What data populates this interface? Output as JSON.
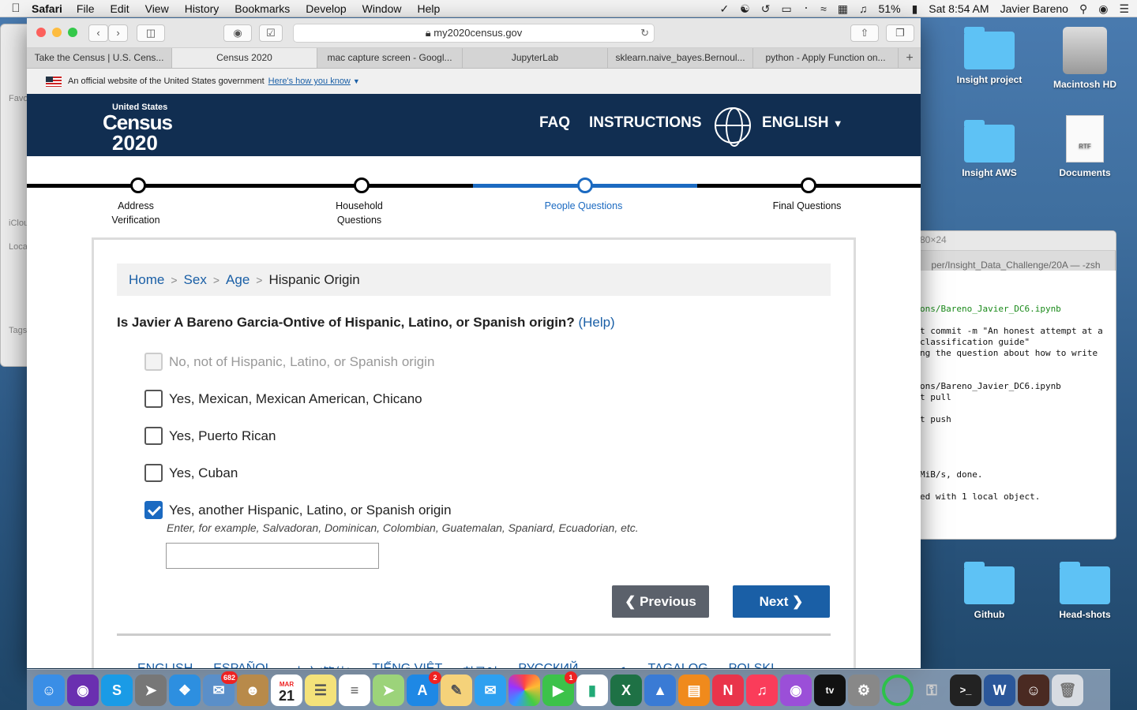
{
  "menubar": {
    "app": "Safari",
    "items": [
      "File",
      "Edit",
      "View",
      "History",
      "Bookmarks",
      "Develop",
      "Window",
      "Help"
    ],
    "battery": "51%",
    "clock": "Sat 8:54 AM",
    "user": "Javier Bareno"
  },
  "desktop": {
    "items": [
      {
        "label": "Insight project"
      },
      {
        "label": "Macintosh HD"
      },
      {
        "label": "Insight AWS"
      },
      {
        "label": "Documents"
      },
      {
        "label": "Github"
      },
      {
        "label": "Head-shots"
      }
    ]
  },
  "terminal": {
    "title": "80×24",
    "tab": "per/Insight_Data_Challenge/20A — -zsh",
    "lines": [
      "ons/Bareno_Javier_DC6.ipynb",
      "t commit -m \"An honest attempt at a",
      "classification guide\"",
      "ng the question about how to write",
      "ons/Bareno_Javier_DC6.ipynb",
      "t pull",
      "t push",
      "MiB/s, done.",
      "ed with 1 local object."
    ]
  },
  "safari": {
    "url": "my2020census.gov",
    "tabs": [
      "Take the Census | U.S. Cens...",
      "Census 2020",
      "mac capture screen - Googl...",
      "JupyterLab",
      "sklearn.naive_bayes.Bernoul...",
      "python - Apply Function on..."
    ],
    "active_tab": 1
  },
  "gov_banner": {
    "text": "An official website of the United States government",
    "link": "Here's how you know"
  },
  "header": {
    "logo_top": "United States",
    "logo_mid": "Census",
    "logo_year": "2020",
    "faq": "FAQ",
    "instructions": "INSTRUCTIONS",
    "language": "ENGLISH"
  },
  "progress": {
    "steps": [
      {
        "label": "Address Verification"
      },
      {
        "label": "Household Questions"
      },
      {
        "label": "People Questions"
      },
      {
        "label": "Final Questions"
      }
    ],
    "current_step": 2
  },
  "breadcrumb": {
    "home": "Home",
    "sex": "Sex",
    "age": "Age",
    "current": "Hispanic Origin"
  },
  "question": {
    "text": "Is Javier A Bareno Garcia-Ontive of Hispanic, Latino, or Spanish origin?",
    "help": "(Help)"
  },
  "options": [
    {
      "label": "No, not of Hispanic, Latino, or Spanish origin",
      "checked": false,
      "disabled": true
    },
    {
      "label": "Yes, Mexican, Mexican American, Chicano",
      "checked": false,
      "disabled": false
    },
    {
      "label": "Yes, Puerto Rican",
      "checked": false,
      "disabled": false
    },
    {
      "label": "Yes, Cuban",
      "checked": false,
      "disabled": false
    },
    {
      "label": "Yes, another Hispanic, Latino, or Spanish origin",
      "checked": true,
      "disabled": false
    }
  ],
  "other": {
    "hint": "Enter, for example, Salvadoran, Dominican, Colombian, Guatemalan, Spaniard, Ecuadorian, etc.",
    "value": ""
  },
  "buttons": {
    "previous": "Previous",
    "next": "Next"
  },
  "languages": [
    "ENGLISH",
    "ESPAÑOL",
    "中文(简体)",
    "TIẾNG VIỆT",
    "한국어",
    "РУССКИЙ",
    "عربي",
    "TAGALOG",
    "POLSKI"
  ],
  "dock": {
    "mail_badge": "682",
    "appstore_badge": "2",
    "facetime_badge": "1",
    "calendar_month": "MAR",
    "calendar_day": "21"
  }
}
